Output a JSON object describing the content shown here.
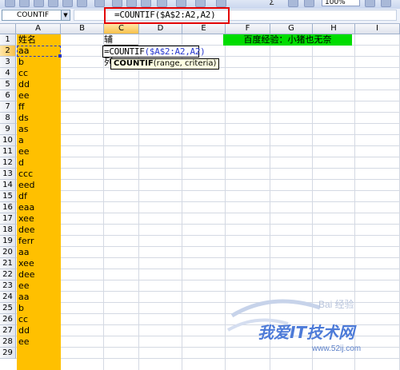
{
  "toolbar": {
    "zoom": "100%",
    "sigma": "Σ"
  },
  "formula_bar": {
    "name_box": "COUNTIF",
    "formula": "=COUNTIF($A$2:A2,A2)"
  },
  "columns": [
    "A",
    "B",
    "C",
    "D",
    "E",
    "F",
    "G",
    "H",
    "I"
  ],
  "active_column": "C",
  "active_row": "2",
  "rows": [
    "1",
    "2",
    "3",
    "4",
    "5",
    "6",
    "7",
    "8",
    "9",
    "10",
    "11",
    "12",
    "13",
    "14",
    "15",
    "16",
    "17",
    "18",
    "19",
    "20",
    "21",
    "22",
    "23",
    "24",
    "25",
    "26",
    "27",
    "28",
    "29"
  ],
  "column_a": [
    "姓名",
    "aa",
    "b",
    "cc",
    "dd",
    "ee",
    "ff",
    "ds",
    "as",
    "a",
    "ee",
    "d",
    "ccc",
    "eed",
    "df",
    "eaa",
    "xee",
    "dee",
    "ferr",
    "aa",
    "xee",
    "dee",
    "ee",
    "aa",
    "b",
    "cc",
    "dd",
    "ee"
  ],
  "cells": {
    "c1": "辅助列",
    "c2_prefix": "=COUNTIF",
    "c2_paren_open": "(",
    "c2_ref": "$A$2:A2",
    "c2_comma": ",",
    "c2_arg": "A2",
    "c2_paren_close": ")",
    "f1": "百度经验：小猪也无奈"
  },
  "tooltip": {
    "func": "COUNTIF",
    "args": "(range, criteria)"
  },
  "watermark": {
    "main": "我爱IT技术网",
    "url": "www.52ij.com",
    "brand": "Bai 经验"
  },
  "colors": {
    "column_a_fill": "#ffc000",
    "note_fill": "#00dd00",
    "highlight_border": "#e30000",
    "ref_blue": "#2a3ad0"
  }
}
